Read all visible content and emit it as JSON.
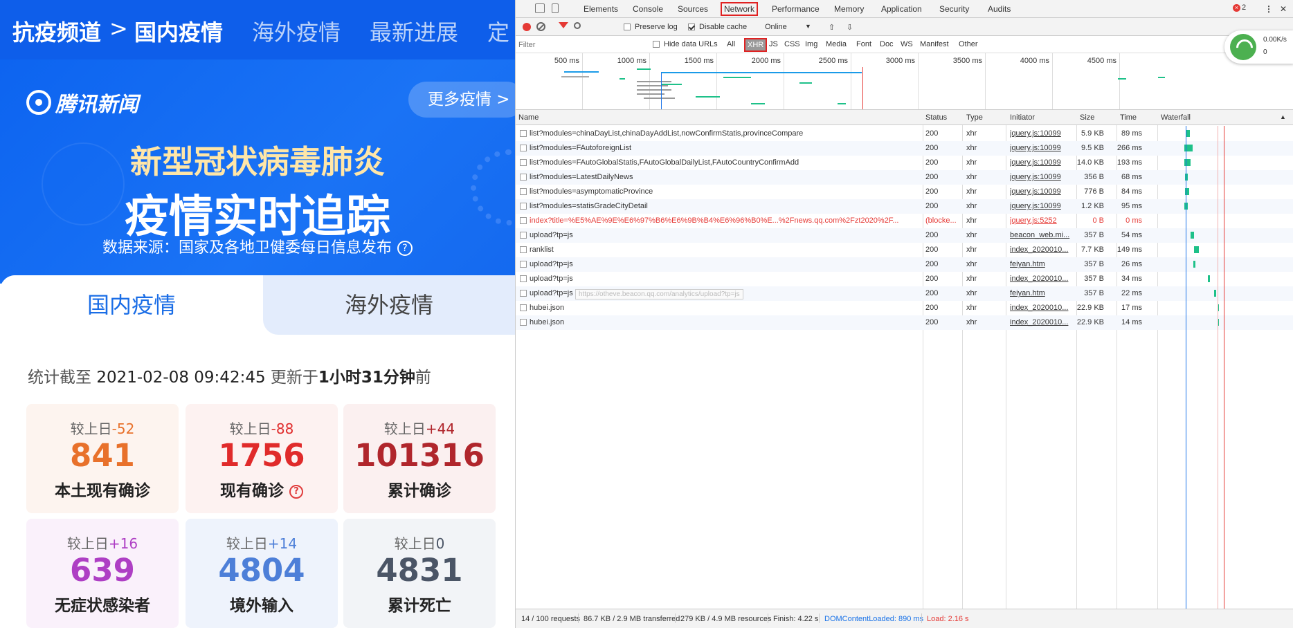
{
  "left": {
    "nav": {
      "channel": "抗疫频道",
      "sep": ">",
      "items": [
        "国内疫情",
        "海外疫情",
        "最新进展",
        "定"
      ]
    },
    "brand": "腾讯新闻",
    "more_btn": "更多疫情 >",
    "title_line1": "新型冠状病毒肺炎",
    "title_line2": "疫情实时追踪",
    "source": "数据来源：国家及各地卫健委每日信息发布",
    "source_icon": "?",
    "tabs": [
      "国内疫情",
      "海外疫情"
    ],
    "stat": {
      "prefix": "统计截至",
      "time": "2021-02-08 09:42:45",
      "updated": "更新于",
      "ago": "1小时31分钟",
      "suffix": "前"
    },
    "cards": [
      {
        "inc_label": "较上日",
        "inc": "-52",
        "value": "841",
        "label": "本土现有确诊",
        "color": "#e8712b",
        "bg": "#fdf4ef"
      },
      {
        "inc_label": "较上日",
        "inc": "-88",
        "value": "1756",
        "label": "现有确诊",
        "color": "#e02b2b",
        "bg": "#fdf2f1",
        "help": "?"
      },
      {
        "inc_label": "较上日",
        "inc": "+44",
        "value": "101316",
        "label": "累计确诊",
        "color": "#b0262c",
        "bg": "#fbf0f0"
      },
      {
        "inc_label": "较上日",
        "inc": "+16",
        "value": "639",
        "label": "无症状感染者",
        "color": "#ae3fc4",
        "bg": "#faf1fb"
      },
      {
        "inc_label": "较上日",
        "inc": "+14",
        "value": "4804",
        "label": "境外输入",
        "color": "#4d7fd8",
        "bg": "#eef3fc"
      },
      {
        "inc_label": "较上日",
        "inc": "0",
        "value": "4831",
        "label": "累计死亡",
        "color": "#4b5566",
        "bg": "#f2f4f7"
      }
    ]
  },
  "devtools": {
    "tabs": [
      "Elements",
      "Console",
      "Sources",
      "Network",
      "Performance",
      "Memory",
      "Application",
      "Security",
      "Audits"
    ],
    "errors": "2",
    "toolbar": {
      "preserve_log": "Preserve log",
      "disable_cache": "Disable cache",
      "throttle": "Online"
    },
    "filter_placeholder": "Filter",
    "filter_types": [
      "Hide data URLs",
      "All",
      "XHR",
      "JS",
      "CSS",
      "Img",
      "Media",
      "Font",
      "Doc",
      "WS",
      "Manifest",
      "Other"
    ],
    "network_badge": {
      "speed": "0.00K/s",
      "count": "0"
    },
    "overview_ticks": [
      "500 ms",
      "1000 ms",
      "1500 ms",
      "2000 ms",
      "2500 ms",
      "3000 ms",
      "3500 ms",
      "4000 ms",
      "4500 ms"
    ],
    "columns": [
      "Name",
      "Status",
      "Type",
      "Initiator",
      "Size",
      "Time",
      "Waterfall"
    ],
    "rows": [
      {
        "name": "list?modules=chinaDayList,chinaDayAddList,nowConfirmStatis,provinceCompare",
        "status": "200",
        "type": "xhr",
        "initiator": "jquery.js:10099",
        "size": "5.9 KB",
        "time": "89 ms"
      },
      {
        "name": "list?modules=FAutoforeignList",
        "status": "200",
        "type": "xhr",
        "initiator": "jquery.js:10099",
        "size": "9.5 KB",
        "time": "266 ms"
      },
      {
        "name": "list?modules=FAutoGlobalStatis,FAutoGlobalDailyList,FAutoCountryConfirmAdd",
        "status": "200",
        "type": "xhr",
        "initiator": "jquery.js:10099",
        "size": "14.0 KB",
        "time": "193 ms"
      },
      {
        "name": "list?modules=LatestDailyNews",
        "status": "200",
        "type": "xhr",
        "initiator": "jquery.js:10099",
        "size": "356 B",
        "time": "68 ms"
      },
      {
        "name": "list?modules=asymptomaticProvince",
        "status": "200",
        "type": "xhr",
        "initiator": "jquery.js:10099",
        "size": "776 B",
        "time": "84 ms"
      },
      {
        "name": "list?modules=statisGradeCityDetail",
        "status": "200",
        "type": "xhr",
        "initiator": "jquery.js:10099",
        "size": "1.2 KB",
        "time": "95 ms"
      },
      {
        "name": "index?title=%E5%AE%9E%E6%97%B6%E6%9B%B4%E6%96%B0%E...%2Fnews.qq.com%2Fzt2020%2F...",
        "status": "(blocke...",
        "type": "xhr",
        "initiator": "jquery.js:5252",
        "size": "0 B",
        "time": "0 ms",
        "blocked": true
      },
      {
        "name": "upload?tp=js",
        "status": "200",
        "type": "xhr",
        "initiator": "beacon_web.mi...",
        "size": "357 B",
        "time": "54 ms"
      },
      {
        "name": "ranklist",
        "status": "200",
        "type": "xhr",
        "initiator": "index_2020010...",
        "size": "7.7 KB",
        "time": "149 ms"
      },
      {
        "name": "upload?tp=js",
        "status": "200",
        "type": "xhr",
        "initiator": "feiyan.htm",
        "size": "357 B",
        "time": "26 ms"
      },
      {
        "name": "upload?tp=js",
        "status": "200",
        "type": "xhr",
        "initiator": "index_2020010...",
        "size": "357 B",
        "time": "34 ms"
      },
      {
        "name": "upload?tp=js",
        "status": "200",
        "type": "xhr",
        "initiator": "feiyan.htm",
        "size": "357 B",
        "time": "22 ms"
      },
      {
        "name": "hubei.json",
        "status": "200",
        "type": "xhr",
        "initiator": "index_2020010...",
        "size": "22.9 KB",
        "time": "17 ms"
      },
      {
        "name": "hubei.json",
        "status": "200",
        "type": "xhr",
        "initiator": "index_2020010...",
        "size": "22.9 KB",
        "time": "14 ms"
      }
    ],
    "tooltip": "https://otheve.beacon.qq.com/analytics/upload?tp=js",
    "status": {
      "requests": "14 / 100 requests",
      "transferred": "86.7 KB / 2.9 MB transferred",
      "resources": "279 KB / 4.9 MB resources",
      "finish": "Finish: 4.22 s",
      "dcl": "DOMContentLoaded: 890 ms",
      "load": "Load: 2.16 s"
    }
  }
}
